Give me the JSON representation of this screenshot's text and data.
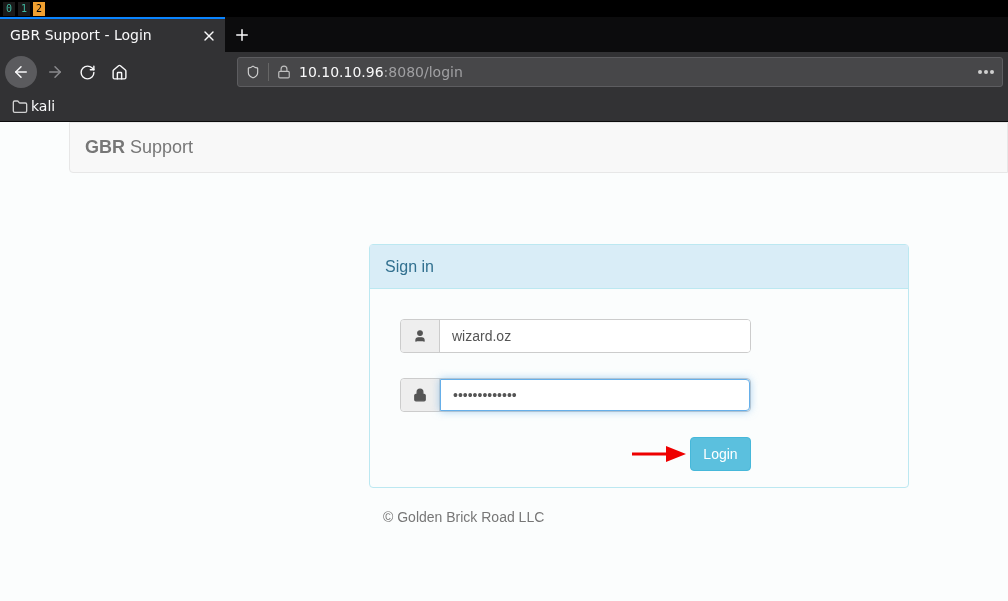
{
  "workspaces": [
    {
      "label": "0",
      "selected": false
    },
    {
      "label": "1",
      "selected": false
    },
    {
      "label": "2",
      "selected": true
    }
  ],
  "tab": {
    "title": "GBR Support - Login",
    "selected": true
  },
  "address": {
    "host": "10.10.10.96",
    "path": ":8080/login"
  },
  "bookmarks": [
    {
      "label": "kali"
    }
  ],
  "navbar": {
    "brand_bold": "GBR",
    "brand_rest": "Support"
  },
  "panel": {
    "title": "Sign in",
    "username": "wizard.oz",
    "password": "•••••••••••••",
    "password_focused": true,
    "button": "Login"
  },
  "footer": "© Golden Brick Road LLC"
}
